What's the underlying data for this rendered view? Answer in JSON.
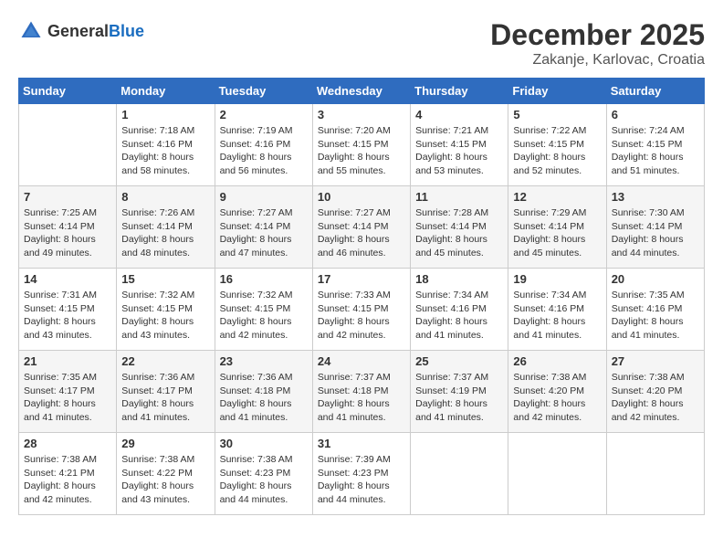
{
  "logo": {
    "general": "General",
    "blue": "Blue"
  },
  "title": {
    "month_year": "December 2025",
    "location": "Zakanje, Karlovac, Croatia"
  },
  "headers": [
    "Sunday",
    "Monday",
    "Tuesday",
    "Wednesday",
    "Thursday",
    "Friday",
    "Saturday"
  ],
  "weeks": [
    [
      {
        "day": "",
        "info": ""
      },
      {
        "day": "1",
        "info": "Sunrise: 7:18 AM\nSunset: 4:16 PM\nDaylight: 8 hours\nand 58 minutes."
      },
      {
        "day": "2",
        "info": "Sunrise: 7:19 AM\nSunset: 4:16 PM\nDaylight: 8 hours\nand 56 minutes."
      },
      {
        "day": "3",
        "info": "Sunrise: 7:20 AM\nSunset: 4:15 PM\nDaylight: 8 hours\nand 55 minutes."
      },
      {
        "day": "4",
        "info": "Sunrise: 7:21 AM\nSunset: 4:15 PM\nDaylight: 8 hours\nand 53 minutes."
      },
      {
        "day": "5",
        "info": "Sunrise: 7:22 AM\nSunset: 4:15 PM\nDaylight: 8 hours\nand 52 minutes."
      },
      {
        "day": "6",
        "info": "Sunrise: 7:24 AM\nSunset: 4:15 PM\nDaylight: 8 hours\nand 51 minutes."
      }
    ],
    [
      {
        "day": "7",
        "info": "Sunrise: 7:25 AM\nSunset: 4:14 PM\nDaylight: 8 hours\nand 49 minutes."
      },
      {
        "day": "8",
        "info": "Sunrise: 7:26 AM\nSunset: 4:14 PM\nDaylight: 8 hours\nand 48 minutes."
      },
      {
        "day": "9",
        "info": "Sunrise: 7:27 AM\nSunset: 4:14 PM\nDaylight: 8 hours\nand 47 minutes."
      },
      {
        "day": "10",
        "info": "Sunrise: 7:27 AM\nSunset: 4:14 PM\nDaylight: 8 hours\nand 46 minutes."
      },
      {
        "day": "11",
        "info": "Sunrise: 7:28 AM\nSunset: 4:14 PM\nDaylight: 8 hours\nand 45 minutes."
      },
      {
        "day": "12",
        "info": "Sunrise: 7:29 AM\nSunset: 4:14 PM\nDaylight: 8 hours\nand 45 minutes."
      },
      {
        "day": "13",
        "info": "Sunrise: 7:30 AM\nSunset: 4:14 PM\nDaylight: 8 hours\nand 44 minutes."
      }
    ],
    [
      {
        "day": "14",
        "info": "Sunrise: 7:31 AM\nSunset: 4:15 PM\nDaylight: 8 hours\nand 43 minutes."
      },
      {
        "day": "15",
        "info": "Sunrise: 7:32 AM\nSunset: 4:15 PM\nDaylight: 8 hours\nand 43 minutes."
      },
      {
        "day": "16",
        "info": "Sunrise: 7:32 AM\nSunset: 4:15 PM\nDaylight: 8 hours\nand 42 minutes."
      },
      {
        "day": "17",
        "info": "Sunrise: 7:33 AM\nSunset: 4:15 PM\nDaylight: 8 hours\nand 42 minutes."
      },
      {
        "day": "18",
        "info": "Sunrise: 7:34 AM\nSunset: 4:16 PM\nDaylight: 8 hours\nand 41 minutes."
      },
      {
        "day": "19",
        "info": "Sunrise: 7:34 AM\nSunset: 4:16 PM\nDaylight: 8 hours\nand 41 minutes."
      },
      {
        "day": "20",
        "info": "Sunrise: 7:35 AM\nSunset: 4:16 PM\nDaylight: 8 hours\nand 41 minutes."
      }
    ],
    [
      {
        "day": "21",
        "info": "Sunrise: 7:35 AM\nSunset: 4:17 PM\nDaylight: 8 hours\nand 41 minutes."
      },
      {
        "day": "22",
        "info": "Sunrise: 7:36 AM\nSunset: 4:17 PM\nDaylight: 8 hours\nand 41 minutes."
      },
      {
        "day": "23",
        "info": "Sunrise: 7:36 AM\nSunset: 4:18 PM\nDaylight: 8 hours\nand 41 minutes."
      },
      {
        "day": "24",
        "info": "Sunrise: 7:37 AM\nSunset: 4:18 PM\nDaylight: 8 hours\nand 41 minutes."
      },
      {
        "day": "25",
        "info": "Sunrise: 7:37 AM\nSunset: 4:19 PM\nDaylight: 8 hours\nand 41 minutes."
      },
      {
        "day": "26",
        "info": "Sunrise: 7:38 AM\nSunset: 4:20 PM\nDaylight: 8 hours\nand 42 minutes."
      },
      {
        "day": "27",
        "info": "Sunrise: 7:38 AM\nSunset: 4:20 PM\nDaylight: 8 hours\nand 42 minutes."
      }
    ],
    [
      {
        "day": "28",
        "info": "Sunrise: 7:38 AM\nSunset: 4:21 PM\nDaylight: 8 hours\nand 42 minutes."
      },
      {
        "day": "29",
        "info": "Sunrise: 7:38 AM\nSunset: 4:22 PM\nDaylight: 8 hours\nand 43 minutes."
      },
      {
        "day": "30",
        "info": "Sunrise: 7:38 AM\nSunset: 4:23 PM\nDaylight: 8 hours\nand 44 minutes."
      },
      {
        "day": "31",
        "info": "Sunrise: 7:39 AM\nSunset: 4:23 PM\nDaylight: 8 hours\nand 44 minutes."
      },
      {
        "day": "",
        "info": ""
      },
      {
        "day": "",
        "info": ""
      },
      {
        "day": "",
        "info": ""
      }
    ]
  ]
}
